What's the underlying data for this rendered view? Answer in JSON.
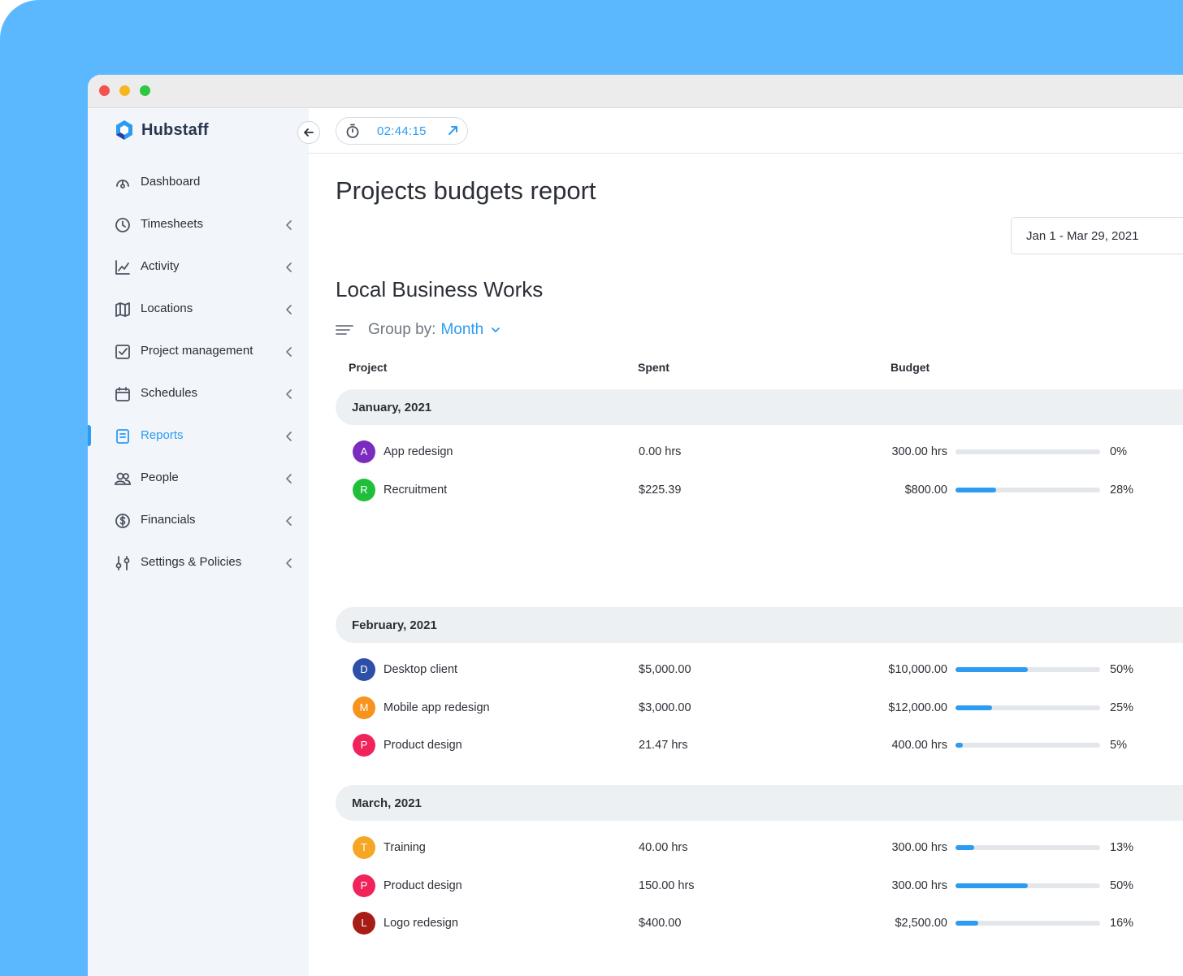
{
  "brand": {
    "name": "Hubstaff",
    "primary": "#2c9cf2",
    "logo_dark": "#283750"
  },
  "sidebar": {
    "items": [
      {
        "label": "Dashboard",
        "icon": "gauge-icon",
        "has_chevron": false,
        "active": false
      },
      {
        "label": "Timesheets",
        "icon": "clock-icon",
        "has_chevron": true,
        "active": false
      },
      {
        "label": "Activity",
        "icon": "chart-line-icon",
        "has_chevron": true,
        "active": false
      },
      {
        "label": "Locations",
        "icon": "map-icon",
        "has_chevron": true,
        "active": false
      },
      {
        "label": "Project management",
        "icon": "checkbox-icon",
        "has_chevron": true,
        "active": false
      },
      {
        "label": "Schedules",
        "icon": "calendar-icon",
        "has_chevron": true,
        "active": false
      },
      {
        "label": "Reports",
        "icon": "report-icon",
        "has_chevron": true,
        "active": true
      },
      {
        "label": "People",
        "icon": "people-icon",
        "has_chevron": true,
        "active": false
      },
      {
        "label": "Financials",
        "icon": "dollar-icon",
        "has_chevron": true,
        "active": false
      },
      {
        "label": "Settings & Policies",
        "icon": "sliders-icon",
        "has_chevron": true,
        "active": false
      }
    ]
  },
  "timer": {
    "time": "02:44:15"
  },
  "page": {
    "title": "Projects budgets report",
    "date_range": "Jan 1 - Mar 29, 2021",
    "org_name": "Local Business Works",
    "group_by_label": "Group by:",
    "group_by_value": "Month"
  },
  "table": {
    "headers": {
      "project": "Project",
      "spent": "Spent",
      "budget": "Budget"
    },
    "groups": [
      {
        "label": "January, 2021",
        "rows": [
          {
            "initial": "A",
            "color": "#7b2cbf",
            "name": "App redesign",
            "spent": "0.00 hrs",
            "budget": "300.00 hrs",
            "percent": "0%",
            "fraction": 0.0
          },
          {
            "initial": "R",
            "color": "#1fbf3a",
            "name": "Recruitment",
            "spent": "$225.39",
            "budget": "$800.00",
            "percent": "28%",
            "fraction": 0.28
          }
        ]
      },
      {
        "label": "February, 2021",
        "rows": [
          {
            "initial": "D",
            "color": "#2d4fa8",
            "name": "Desktop client",
            "spent": "$5,000.00",
            "budget": "$10,000.00",
            "percent": "50%",
            "fraction": 0.5
          },
          {
            "initial": "M",
            "color": "#f7941d",
            "name": "Mobile app redesign",
            "spent": "$3,000.00",
            "budget": "$12,000.00",
            "percent": "25%",
            "fraction": 0.25
          },
          {
            "initial": "P",
            "color": "#f0245a",
            "name": "Product design",
            "spent": "21.47 hrs",
            "budget": "400.00 hrs",
            "percent": "5%",
            "fraction": 0.05
          }
        ]
      },
      {
        "label": "March, 2021",
        "rows": [
          {
            "initial": "T",
            "color": "#f5a623",
            "name": "Training",
            "spent": "40.00 hrs",
            "budget": "300.00 hrs",
            "percent": "13%",
            "fraction": 0.13
          },
          {
            "initial": "P",
            "color": "#f0245a",
            "name": "Product design",
            "spent": "150.00 hrs",
            "budget": "300.00 hrs",
            "percent": "50%",
            "fraction": 0.5
          },
          {
            "initial": "L",
            "color": "#a81c16",
            "name": "Logo redesign",
            "spent": "$400.00",
            "budget": "$2,500.00",
            "percent": "16%",
            "fraction": 0.16
          }
        ]
      }
    ]
  }
}
